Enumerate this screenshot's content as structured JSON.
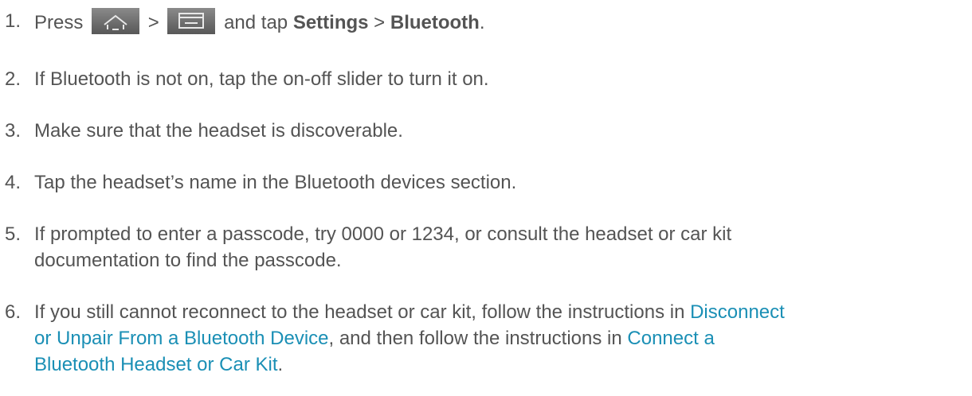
{
  "steps": [
    {
      "num": "1.",
      "press": "Press",
      "gt1": ">",
      "and_tap": "and tap",
      "settings": "Settings",
      "gt2": ">",
      "bluetooth": "Bluetooth",
      "period": ".",
      "icons": [
        "home-key-icon",
        "menu-key-icon"
      ]
    },
    {
      "num": "2.",
      "text": "If Bluetooth is not on, tap the on-off slider to turn it on."
    },
    {
      "num": "3.",
      "text": "Make sure that the headset is discoverable."
    },
    {
      "num": "4.",
      "text": "Tap the headset’s name in the Bluetooth devices section."
    },
    {
      "num": "5.",
      "line1": "If prompted to enter a passcode, try 0000 or 1234, or consult the headset or car kit",
      "line2": "documentation to find the passcode."
    },
    {
      "num": "6.",
      "part1": "If you still cannot reconnect to the headset or car kit, follow the instructions in",
      "link1a": "Disconnect",
      "link1b": "or Unpair From a Bluetooth Device",
      "part2": ", and then follow the instructions in",
      "link2a": "Connect a",
      "link2b": "Bluetooth Headset or Car Kit",
      "period": "."
    }
  ],
  "colors": {
    "text": "#545454",
    "link": "#1a8fb5",
    "icon_bg": "#6e6e6e"
  }
}
